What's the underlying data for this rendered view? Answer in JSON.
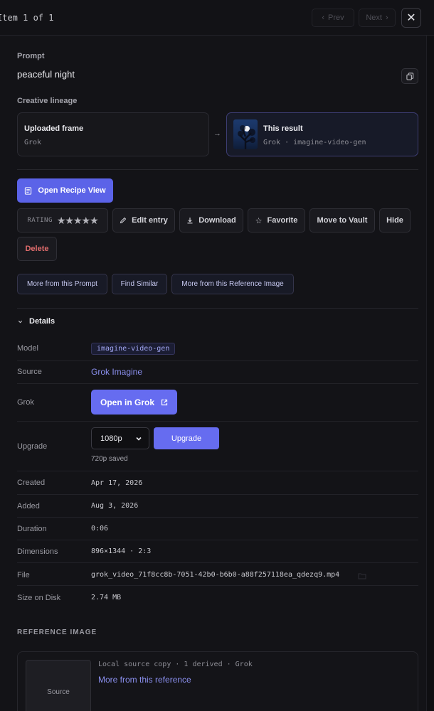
{
  "topbar": {
    "item_counter": "Item 1 of 1",
    "prev_label": "Prev",
    "next_label": "Next",
    "close_glyph": "✕"
  },
  "prompt": {
    "label": "Prompt",
    "text": "peaceful night"
  },
  "lineage": {
    "label": "Creative lineage",
    "uploaded": {
      "title": "Uploaded frame",
      "subtitle": "Grok"
    },
    "arrow": "→",
    "result": {
      "title": "This result",
      "subtitle": "Grok · imagine-video-gen"
    }
  },
  "actions": {
    "recipe_label": "Open Recipe View",
    "rating_label": "RATING",
    "rating_stars": "★★★★★",
    "edit_label": "Edit entry",
    "download_label": "Download",
    "favorite_label": "Favorite",
    "vault_label": "Move to Vault",
    "hide_label": "Hide",
    "delete_label": "Delete"
  },
  "related": {
    "prompt_label": "More from this Prompt",
    "similar_label": "Find Similar",
    "reference_label": "More from this Reference Image"
  },
  "details": {
    "header": "Details",
    "model_label": "Model",
    "model_value": "imagine-video-gen",
    "source_label": "Source",
    "source_value": "Grok Imagine",
    "grok_label": "Grok",
    "open_grok_label": "Open in Grok",
    "upgrade_label": "Upgrade",
    "upgrade_selected": "1080p",
    "upgrade_button": "Upgrade",
    "upgrade_note": "720p saved",
    "created_label": "Created",
    "created_value": "Apr 17, 2026",
    "added_label": "Added",
    "added_value": "Aug 3, 2026",
    "duration_label": "Duration",
    "duration_value": "0:06",
    "dimensions_label": "Dimensions",
    "dimensions_value": "896×1344 · 2:3",
    "file_label": "File",
    "file_value": "grok_video_71f8cc8b-7051-42b0-b6b0-a88f257118ea_qdezq9.mp4",
    "size_label": "Size on Disk",
    "size_value": "2.74 MB"
  },
  "reference": {
    "header": "REFERENCE IMAGE",
    "thumb_label": "Source",
    "meta": "Local source copy · 1 derived · Grok",
    "link": "More from this reference"
  },
  "colors": {
    "accent": "#5b63e8",
    "danger": "#e06c6c",
    "link": "#8b90ef"
  }
}
